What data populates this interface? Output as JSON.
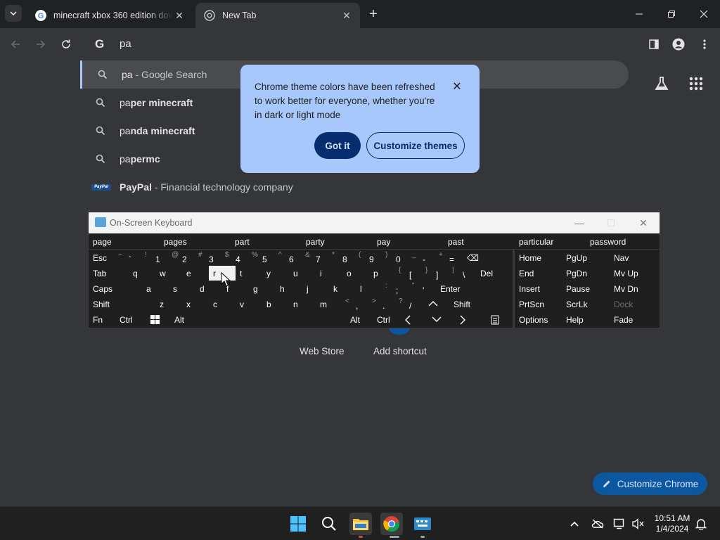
{
  "browser": {
    "tabs": [
      {
        "title": "minecraft xbox 360 edition dow",
        "active": false
      },
      {
        "title": "New Tab",
        "active": true
      }
    ],
    "omnibox_value": "pa",
    "omnibox_icon": "G"
  },
  "suggestions": [
    {
      "icon": "search-icon",
      "bold": "",
      "match": "pa",
      "rest": " - Google Search",
      "selected": true
    },
    {
      "icon": "search-icon",
      "match": "pa",
      "bold": "per minecraft",
      "rest": ""
    },
    {
      "icon": "search-icon",
      "match": "pa",
      "bold": "nda minecraft",
      "rest": ""
    },
    {
      "icon": "search-icon",
      "match": "pa",
      "bold": "permc",
      "rest": ""
    },
    {
      "icon": "paypal-icon",
      "bold": "PayPal",
      "match": "",
      "rest": " - Financial technology company",
      "logo_text": "PayPal"
    }
  ],
  "theme_bubble": {
    "message": "Chrome theme colors have been refreshed to work better for everyone, whether you're in dark or light mode",
    "got_it": "Got it",
    "customize_themes": "Customize themes"
  },
  "ntp": {
    "shortcuts": [
      {
        "label": "Web Store"
      },
      {
        "label": "Add shortcut"
      }
    ],
    "customize_chrome": "Customize Chrome"
  },
  "osk": {
    "title": "On-Screen Keyboard",
    "predictions": [
      "page",
      "pages",
      "part",
      "party",
      "pay",
      "past",
      "particular",
      "password"
    ],
    "row1": [
      {
        "main": "Esc"
      },
      {
        "up": "~",
        "low": "`"
      },
      {
        "up": "!",
        "low": "1"
      },
      {
        "up": "@",
        "low": "2"
      },
      {
        "up": "#",
        "low": "3"
      },
      {
        "up": "$",
        "low": "4"
      },
      {
        "up": "%",
        "low": "5"
      },
      {
        "up": "^",
        "low": "6"
      },
      {
        "up": "&",
        "low": "7"
      },
      {
        "up": "*",
        "low": "8"
      },
      {
        "up": "(",
        "low": "9"
      },
      {
        "up": ")",
        "low": "0"
      },
      {
        "up": "_",
        "low": "-"
      },
      {
        "up": "+",
        "low": "="
      },
      {
        "main": "⌫"
      }
    ],
    "row2": [
      "Tab",
      "q",
      "w",
      "e",
      "r",
      "t",
      "y",
      "u",
      "i",
      "o",
      "p"
    ],
    "row2_brackets": [
      {
        "up": "{",
        "low": "["
      },
      {
        "up": "}",
        "low": "]"
      },
      {
        "up": "|",
        "low": "\\"
      }
    ],
    "row2_del": "Del",
    "row3": [
      "Caps",
      "a",
      "s",
      "d",
      "f",
      "g",
      "h",
      "j",
      "k",
      "l"
    ],
    "row3_punct": [
      {
        "up": ":",
        "low": ";"
      },
      {
        "up": "\"",
        "low": "'"
      }
    ],
    "row3_enter": "Enter",
    "row4": [
      "Shift",
      "z",
      "x",
      "c",
      "v",
      "b",
      "n",
      "m"
    ],
    "row4_punct": [
      {
        "up": "<",
        "low": ","
      },
      {
        "up": ">",
        "low": "."
      },
      {
        "up": "?",
        "low": "/"
      }
    ],
    "row4_shift_right": "Shift",
    "row5": [
      "Fn",
      "Ctrl",
      "Alt",
      "Alt",
      "Ctrl"
    ],
    "nav_keys": [
      [
        "Home",
        "PgUp",
        "Nav"
      ],
      [
        "End",
        "PgDn",
        "Mv Up"
      ],
      [
        "Insert",
        "Pause",
        "Mv Dn"
      ],
      [
        "PrtScn",
        "ScrLk",
        "Dock"
      ],
      [
        "Options",
        "Help",
        "Fade"
      ]
    ],
    "pressed_key": "r"
  },
  "taskbar": {
    "time": "10:51 AM",
    "date": "1/4/2024"
  },
  "colors": {
    "bg": "#35363a",
    "tabstrip": "#202124",
    "bubble": "#a8c7fa",
    "bubble_primary": "#062e6f",
    "chip": "#0b57a0"
  }
}
